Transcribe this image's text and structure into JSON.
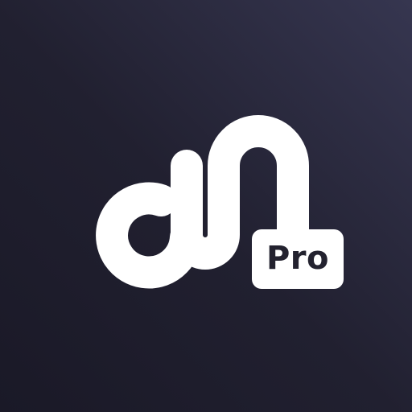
{
  "icon": {
    "badge_label": "Pro",
    "logo_icon": "link-loop-icon",
    "colors": {
      "background_dark": "#1a1927",
      "background_light": "#363650",
      "mark": "#ffffff",
      "badge_text": "#23222f"
    }
  }
}
